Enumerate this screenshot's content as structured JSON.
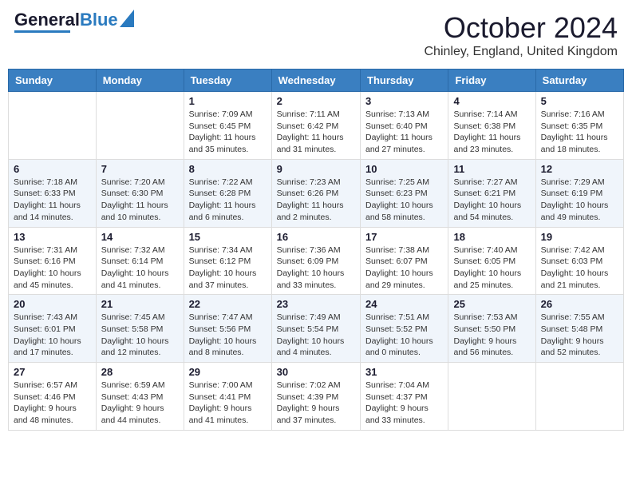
{
  "header": {
    "logo_general": "General",
    "logo_blue": "Blue",
    "month": "October 2024",
    "location": "Chinley, England, United Kingdom"
  },
  "days_of_week": [
    "Sunday",
    "Monday",
    "Tuesday",
    "Wednesday",
    "Thursday",
    "Friday",
    "Saturday"
  ],
  "weeks": [
    [
      {
        "day": "",
        "sunrise": "",
        "sunset": "",
        "daylight": ""
      },
      {
        "day": "",
        "sunrise": "",
        "sunset": "",
        "daylight": ""
      },
      {
        "day": "1",
        "sunrise": "Sunrise: 7:09 AM",
        "sunset": "Sunset: 6:45 PM",
        "daylight": "Daylight: 11 hours and 35 minutes."
      },
      {
        "day": "2",
        "sunrise": "Sunrise: 7:11 AM",
        "sunset": "Sunset: 6:42 PM",
        "daylight": "Daylight: 11 hours and 31 minutes."
      },
      {
        "day": "3",
        "sunrise": "Sunrise: 7:13 AM",
        "sunset": "Sunset: 6:40 PM",
        "daylight": "Daylight: 11 hours and 27 minutes."
      },
      {
        "day": "4",
        "sunrise": "Sunrise: 7:14 AM",
        "sunset": "Sunset: 6:38 PM",
        "daylight": "Daylight: 11 hours and 23 minutes."
      },
      {
        "day": "5",
        "sunrise": "Sunrise: 7:16 AM",
        "sunset": "Sunset: 6:35 PM",
        "daylight": "Daylight: 11 hours and 18 minutes."
      }
    ],
    [
      {
        "day": "6",
        "sunrise": "Sunrise: 7:18 AM",
        "sunset": "Sunset: 6:33 PM",
        "daylight": "Daylight: 11 hours and 14 minutes."
      },
      {
        "day": "7",
        "sunrise": "Sunrise: 7:20 AM",
        "sunset": "Sunset: 6:30 PM",
        "daylight": "Daylight: 11 hours and 10 minutes."
      },
      {
        "day": "8",
        "sunrise": "Sunrise: 7:22 AM",
        "sunset": "Sunset: 6:28 PM",
        "daylight": "Daylight: 11 hours and 6 minutes."
      },
      {
        "day": "9",
        "sunrise": "Sunrise: 7:23 AM",
        "sunset": "Sunset: 6:26 PM",
        "daylight": "Daylight: 11 hours and 2 minutes."
      },
      {
        "day": "10",
        "sunrise": "Sunrise: 7:25 AM",
        "sunset": "Sunset: 6:23 PM",
        "daylight": "Daylight: 10 hours and 58 minutes."
      },
      {
        "day": "11",
        "sunrise": "Sunrise: 7:27 AM",
        "sunset": "Sunset: 6:21 PM",
        "daylight": "Daylight: 10 hours and 54 minutes."
      },
      {
        "day": "12",
        "sunrise": "Sunrise: 7:29 AM",
        "sunset": "Sunset: 6:19 PM",
        "daylight": "Daylight: 10 hours and 49 minutes."
      }
    ],
    [
      {
        "day": "13",
        "sunrise": "Sunrise: 7:31 AM",
        "sunset": "Sunset: 6:16 PM",
        "daylight": "Daylight: 10 hours and 45 minutes."
      },
      {
        "day": "14",
        "sunrise": "Sunrise: 7:32 AM",
        "sunset": "Sunset: 6:14 PM",
        "daylight": "Daylight: 10 hours and 41 minutes."
      },
      {
        "day": "15",
        "sunrise": "Sunrise: 7:34 AM",
        "sunset": "Sunset: 6:12 PM",
        "daylight": "Daylight: 10 hours and 37 minutes."
      },
      {
        "day": "16",
        "sunrise": "Sunrise: 7:36 AM",
        "sunset": "Sunset: 6:09 PM",
        "daylight": "Daylight: 10 hours and 33 minutes."
      },
      {
        "day": "17",
        "sunrise": "Sunrise: 7:38 AM",
        "sunset": "Sunset: 6:07 PM",
        "daylight": "Daylight: 10 hours and 29 minutes."
      },
      {
        "day": "18",
        "sunrise": "Sunrise: 7:40 AM",
        "sunset": "Sunset: 6:05 PM",
        "daylight": "Daylight: 10 hours and 25 minutes."
      },
      {
        "day": "19",
        "sunrise": "Sunrise: 7:42 AM",
        "sunset": "Sunset: 6:03 PM",
        "daylight": "Daylight: 10 hours and 21 minutes."
      }
    ],
    [
      {
        "day": "20",
        "sunrise": "Sunrise: 7:43 AM",
        "sunset": "Sunset: 6:01 PM",
        "daylight": "Daylight: 10 hours and 17 minutes."
      },
      {
        "day": "21",
        "sunrise": "Sunrise: 7:45 AM",
        "sunset": "Sunset: 5:58 PM",
        "daylight": "Daylight: 10 hours and 12 minutes."
      },
      {
        "day": "22",
        "sunrise": "Sunrise: 7:47 AM",
        "sunset": "Sunset: 5:56 PM",
        "daylight": "Daylight: 10 hours and 8 minutes."
      },
      {
        "day": "23",
        "sunrise": "Sunrise: 7:49 AM",
        "sunset": "Sunset: 5:54 PM",
        "daylight": "Daylight: 10 hours and 4 minutes."
      },
      {
        "day": "24",
        "sunrise": "Sunrise: 7:51 AM",
        "sunset": "Sunset: 5:52 PM",
        "daylight": "Daylight: 10 hours and 0 minutes."
      },
      {
        "day": "25",
        "sunrise": "Sunrise: 7:53 AM",
        "sunset": "Sunset: 5:50 PM",
        "daylight": "Daylight: 9 hours and 56 minutes."
      },
      {
        "day": "26",
        "sunrise": "Sunrise: 7:55 AM",
        "sunset": "Sunset: 5:48 PM",
        "daylight": "Daylight: 9 hours and 52 minutes."
      }
    ],
    [
      {
        "day": "27",
        "sunrise": "Sunrise: 6:57 AM",
        "sunset": "Sunset: 4:46 PM",
        "daylight": "Daylight: 9 hours and 48 minutes."
      },
      {
        "day": "28",
        "sunrise": "Sunrise: 6:59 AM",
        "sunset": "Sunset: 4:43 PM",
        "daylight": "Daylight: 9 hours and 44 minutes."
      },
      {
        "day": "29",
        "sunrise": "Sunrise: 7:00 AM",
        "sunset": "Sunset: 4:41 PM",
        "daylight": "Daylight: 9 hours and 41 minutes."
      },
      {
        "day": "30",
        "sunrise": "Sunrise: 7:02 AM",
        "sunset": "Sunset: 4:39 PM",
        "daylight": "Daylight: 9 hours and 37 minutes."
      },
      {
        "day": "31",
        "sunrise": "Sunrise: 7:04 AM",
        "sunset": "Sunset: 4:37 PM",
        "daylight": "Daylight: 9 hours and 33 minutes."
      },
      {
        "day": "",
        "sunrise": "",
        "sunset": "",
        "daylight": ""
      },
      {
        "day": "",
        "sunrise": "",
        "sunset": "",
        "daylight": ""
      }
    ]
  ]
}
